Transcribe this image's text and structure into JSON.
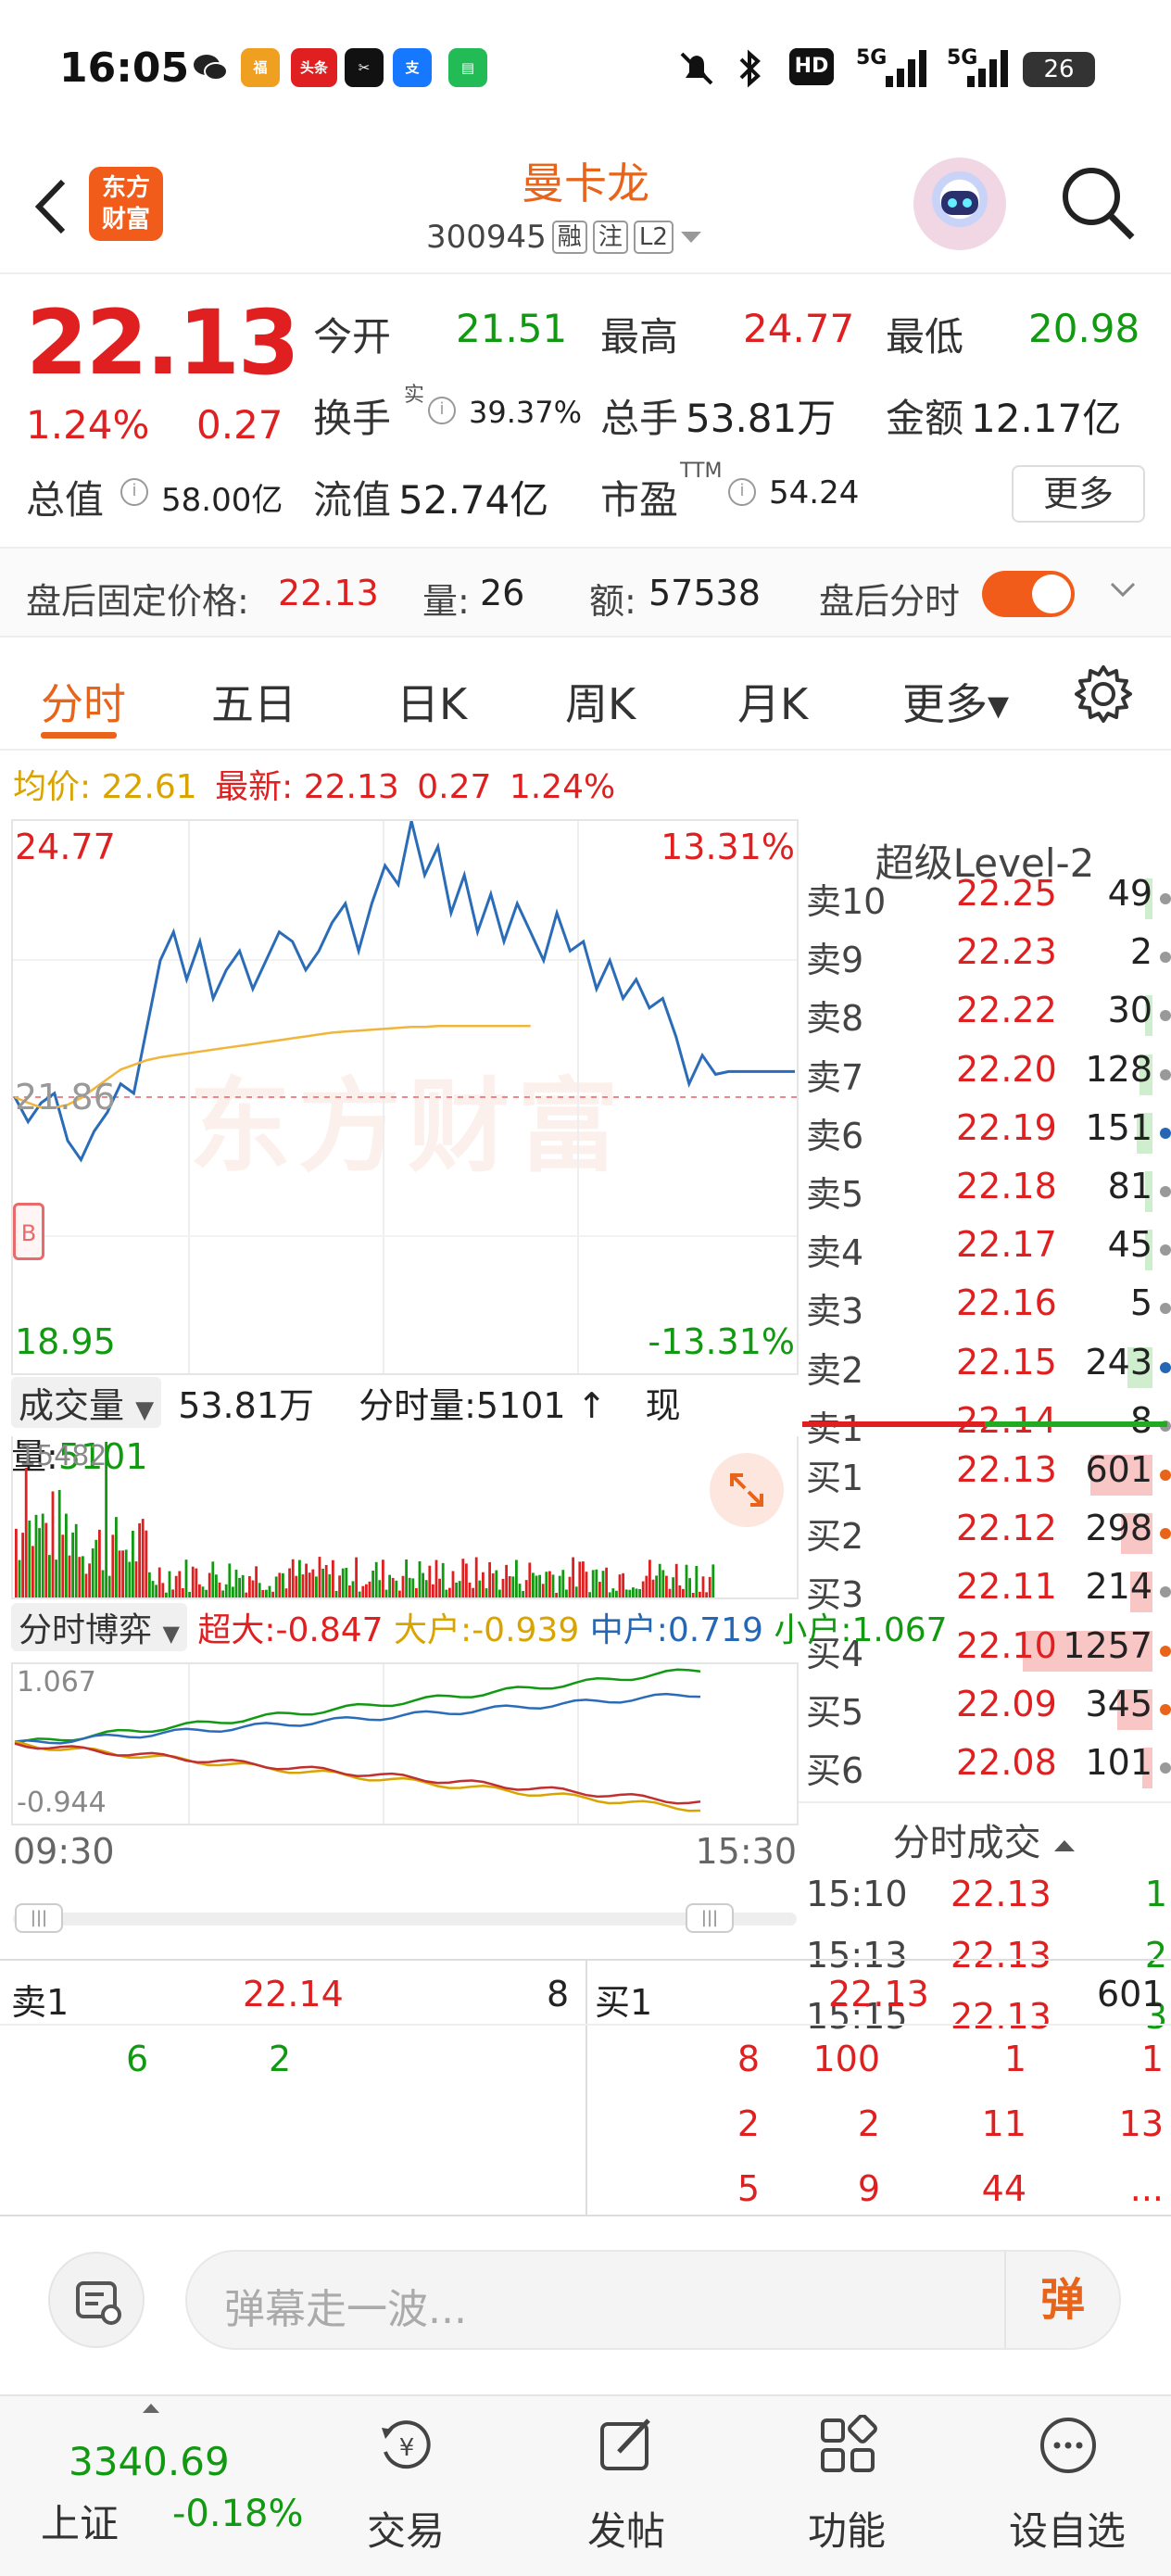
{
  "status_bar": {
    "time": "16:05",
    "network": "5G",
    "battery": "26",
    "app_icons": [
      {
        "name": "app-icon-1",
        "label": "福",
        "color": "#f0a020"
      },
      {
        "name": "toutiao-icon",
        "label": "头条",
        "color": "#e02020"
      },
      {
        "name": "capcut-icon",
        "label": "✂",
        "color": "#111111"
      },
      {
        "name": "alipay-icon",
        "label": "支",
        "color": "#1677ff"
      },
      {
        "name": "message-icon",
        "label": "▤",
        "color": "#22bb55"
      }
    ]
  },
  "header": {
    "stock_name": "曼卡龙",
    "stock_code": "300945",
    "tags": [
      "融",
      "注",
      "L2"
    ],
    "logo_text_1": "东方",
    "logo_text_2": "财富"
  },
  "quote": {
    "price": "22.13",
    "change_pct": "1.24%",
    "change_amt": "0.27",
    "open_label": "今开",
    "open": "21.51",
    "high_label": "最高",
    "high": "24.77",
    "low_label": "最低",
    "low": "20.98",
    "turnover_label": "换手",
    "turnover_sup": "实",
    "turnover": "39.37%",
    "total_vol_label": "总手",
    "total_vol": "53.81万",
    "amount_label": "金额",
    "amount": "12.17亿",
    "mktcap_label": "总值",
    "mktcap": "58.00亿",
    "float_label": "流值",
    "float_cap": "52.74亿",
    "pe_label": "市盈",
    "pe_sup": "TTM",
    "pe": "54.24",
    "more_button": "更多"
  },
  "after_hours": {
    "price_label": "盘后固定价格:",
    "price": "22.13",
    "vol_label": "量:",
    "vol": "26",
    "amt_label": "额:",
    "amt": "57538",
    "toggle_label": "盘后分时"
  },
  "tabs": [
    "分时",
    "五日",
    "日K",
    "周K",
    "月K",
    "更多▾"
  ],
  "info_line": {
    "avg_label": "均价:",
    "avg": "22.61",
    "latest_label": "最新:",
    "latest": "22.13",
    "chg": "0.27",
    "pct": "1.24%"
  },
  "chart_labels": {
    "top_price": "24.77",
    "top_pct": "13.31%",
    "bottom_price": "18.95",
    "bottom_pct": "-13.31%",
    "mid_price": "21.86",
    "watermark": "东方财富",
    "b_marker": "B"
  },
  "chart_data": [
    {
      "type": "line",
      "title": "",
      "xlabel": "",
      "ylabel": "",
      "ylim": [
        18.95,
        24.77
      ],
      "x_range": [
        "09:30",
        "15:30"
      ],
      "series": [
        {
          "values": [
            21.86,
            21.6,
            21.8,
            21.9,
            21.4,
            21.2,
            21.5,
            21.7,
            22.0,
            21.9,
            22.6,
            23.3,
            23.6,
            23.1,
            23.5,
            22.9,
            23.2,
            23.4,
            23.0,
            23.3,
            23.6,
            23.5,
            23.2,
            23.4,
            23.7,
            23.9,
            23.4,
            23.9,
            24.3,
            24.1,
            24.77,
            24.2,
            24.5,
            23.8,
            24.2,
            23.6,
            24.0,
            23.5,
            23.9,
            23.6,
            23.3,
            23.8,
            23.4,
            23.5,
            23.0,
            23.3,
            22.9,
            23.1,
            22.8,
            22.9,
            22.5,
            22.0,
            22.3,
            22.1,
            22.13,
            22.13,
            22.13,
            22.13,
            22.13,
            22.13
          ]
        },
        {
          "values": [
            21.86,
            21.8,
            21.75,
            21.75,
            21.78,
            21.85,
            21.95,
            22.05,
            22.15,
            22.2,
            22.25,
            22.28,
            22.3,
            22.32,
            22.34,
            22.36,
            22.38,
            22.4,
            22.42,
            22.44,
            22.46,
            22.48,
            22.5,
            22.52,
            22.54,
            22.55,
            22.56,
            22.57,
            22.58,
            22.59,
            22.6,
            22.6,
            22.61,
            22.61,
            22.61,
            22.61,
            22.61,
            22.61,
            22.61,
            22.61
          ]
        }
      ]
    }
  ],
  "level2": {
    "title": "超级Level-2",
    "asks": [
      {
        "label": "卖10",
        "price": "22.25",
        "vol": "49",
        "bar": 0.04,
        "dot": "#999999"
      },
      {
        "label": "卖9",
        "price": "22.23",
        "vol": "2",
        "bar": 0.0,
        "dot": "#999999"
      },
      {
        "label": "卖8",
        "price": "22.22",
        "vol": "30",
        "bar": 0.02,
        "dot": "#999999"
      },
      {
        "label": "卖7",
        "price": "22.20",
        "vol": "128",
        "bar": 0.1,
        "dot": "#999999"
      },
      {
        "label": "卖6",
        "price": "22.19",
        "vol": "151",
        "bar": 0.12,
        "dot": "#2667b5"
      },
      {
        "label": "卖5",
        "price": "22.18",
        "vol": "81",
        "bar": 0.06,
        "dot": "#999999"
      },
      {
        "label": "卖4",
        "price": "22.17",
        "vol": "45",
        "bar": 0.04,
        "dot": "#999999"
      },
      {
        "label": "卖3",
        "price": "22.16",
        "vol": "5",
        "bar": 0.0,
        "dot": "#999999"
      },
      {
        "label": "卖2",
        "price": "22.15",
        "vol": "243",
        "bar": 0.19,
        "dot": "#2667b5"
      },
      {
        "label": "卖1",
        "price": "22.14",
        "vol": "8",
        "bar": 0.0,
        "dot": "#999999"
      }
    ],
    "bids": [
      {
        "label": "买1",
        "price": "22.13",
        "vol": "601",
        "bar": 0.48,
        "dot": "#e8641b"
      },
      {
        "label": "买2",
        "price": "22.12",
        "vol": "298",
        "bar": 0.24,
        "dot": "#e8641b"
      },
      {
        "label": "买3",
        "price": "22.11",
        "vol": "214",
        "bar": 0.17,
        "dot": "#999999"
      },
      {
        "label": "买4",
        "price": "22.10",
        "vol": "1257",
        "bar": 1.0,
        "dot": "#e8641b"
      },
      {
        "label": "买5",
        "price": "22.09",
        "vol": "345",
        "bar": 0.27,
        "dot": "#e8641b"
      },
      {
        "label": "买6",
        "price": "22.08",
        "vol": "101",
        "bar": 0.08,
        "dot": "#999999"
      }
    ],
    "trades_title": "分时成交",
    "trades": [
      {
        "time": "15:10",
        "price": "22.13",
        "vol": "1"
      },
      {
        "time": "15:13",
        "price": "22.13",
        "vol": "2"
      },
      {
        "time": "15:15",
        "price": "22.13",
        "vol": "3"
      }
    ]
  },
  "volume": {
    "selector": "成交量",
    "total": "53.81万",
    "minute_label": "分时量:",
    "minute": "5101",
    "current_label": "现量:",
    "current": "5101",
    "max_label": "15482"
  },
  "game": {
    "selector": "分时博弈",
    "super_label": "超大:",
    "super": "-0.847",
    "large_label": "大户:",
    "large": "-0.939",
    "mid_label": "中户:",
    "mid": "0.719",
    "small_label": "小户:",
    "small": "1.067",
    "max_label": "1.067",
    "min_label": "-0.944"
  },
  "time_axis": {
    "start": "09:30",
    "end": "15:30"
  },
  "order_book": {
    "sell_label": "卖1",
    "sell_price": "22.14",
    "sell_vol": "8",
    "buy_label": "买1",
    "buy_price": "22.13",
    "buy_vol": "601",
    "sell_queue": [
      "6",
      "2"
    ],
    "buy_queue": [
      [
        "8",
        "100",
        "1",
        "1"
      ],
      [
        "2",
        "2",
        "11",
        "13"
      ],
      [
        "5",
        "9",
        "44",
        "..."
      ]
    ]
  },
  "danmu": {
    "placeholder": "弹幕走一波...",
    "send": "弹"
  },
  "bottom_nav": {
    "index_value": "3340.69",
    "index_name": "上证",
    "index_pct": "-0.18%",
    "items": [
      "交易",
      "发帖",
      "功能",
      "设自选"
    ]
  }
}
